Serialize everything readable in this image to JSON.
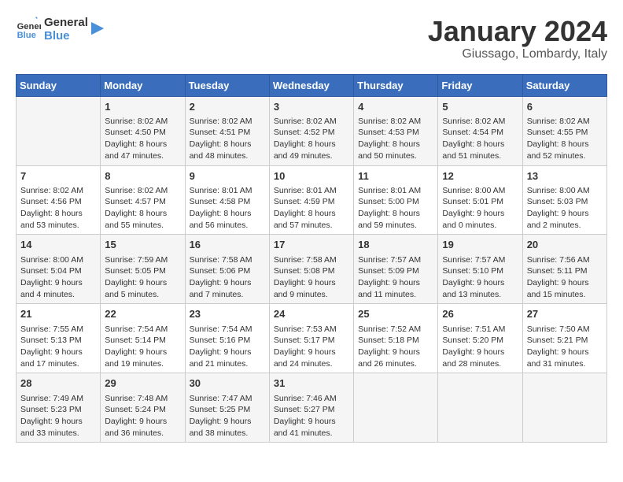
{
  "header": {
    "logo_line1": "General",
    "logo_line2": "Blue",
    "month": "January 2024",
    "location": "Giussago, Lombardy, Italy"
  },
  "days_of_week": [
    "Sunday",
    "Monday",
    "Tuesday",
    "Wednesday",
    "Thursday",
    "Friday",
    "Saturday"
  ],
  "weeks": [
    [
      {
        "day": "",
        "info": ""
      },
      {
        "day": "1",
        "info": "Sunrise: 8:02 AM\nSunset: 4:50 PM\nDaylight: 8 hours\nand 47 minutes."
      },
      {
        "day": "2",
        "info": "Sunrise: 8:02 AM\nSunset: 4:51 PM\nDaylight: 8 hours\nand 48 minutes."
      },
      {
        "day": "3",
        "info": "Sunrise: 8:02 AM\nSunset: 4:52 PM\nDaylight: 8 hours\nand 49 minutes."
      },
      {
        "day": "4",
        "info": "Sunrise: 8:02 AM\nSunset: 4:53 PM\nDaylight: 8 hours\nand 50 minutes."
      },
      {
        "day": "5",
        "info": "Sunrise: 8:02 AM\nSunset: 4:54 PM\nDaylight: 8 hours\nand 51 minutes."
      },
      {
        "day": "6",
        "info": "Sunrise: 8:02 AM\nSunset: 4:55 PM\nDaylight: 8 hours\nand 52 minutes."
      }
    ],
    [
      {
        "day": "7",
        "info": "Sunrise: 8:02 AM\nSunset: 4:56 PM\nDaylight: 8 hours\nand 53 minutes."
      },
      {
        "day": "8",
        "info": "Sunrise: 8:02 AM\nSunset: 4:57 PM\nDaylight: 8 hours\nand 55 minutes."
      },
      {
        "day": "9",
        "info": "Sunrise: 8:01 AM\nSunset: 4:58 PM\nDaylight: 8 hours\nand 56 minutes."
      },
      {
        "day": "10",
        "info": "Sunrise: 8:01 AM\nSunset: 4:59 PM\nDaylight: 8 hours\nand 57 minutes."
      },
      {
        "day": "11",
        "info": "Sunrise: 8:01 AM\nSunset: 5:00 PM\nDaylight: 8 hours\nand 59 minutes."
      },
      {
        "day": "12",
        "info": "Sunrise: 8:00 AM\nSunset: 5:01 PM\nDaylight: 9 hours\nand 0 minutes."
      },
      {
        "day": "13",
        "info": "Sunrise: 8:00 AM\nSunset: 5:03 PM\nDaylight: 9 hours\nand 2 minutes."
      }
    ],
    [
      {
        "day": "14",
        "info": "Sunrise: 8:00 AM\nSunset: 5:04 PM\nDaylight: 9 hours\nand 4 minutes."
      },
      {
        "day": "15",
        "info": "Sunrise: 7:59 AM\nSunset: 5:05 PM\nDaylight: 9 hours\nand 5 minutes."
      },
      {
        "day": "16",
        "info": "Sunrise: 7:58 AM\nSunset: 5:06 PM\nDaylight: 9 hours\nand 7 minutes."
      },
      {
        "day": "17",
        "info": "Sunrise: 7:58 AM\nSunset: 5:08 PM\nDaylight: 9 hours\nand 9 minutes."
      },
      {
        "day": "18",
        "info": "Sunrise: 7:57 AM\nSunset: 5:09 PM\nDaylight: 9 hours\nand 11 minutes."
      },
      {
        "day": "19",
        "info": "Sunrise: 7:57 AM\nSunset: 5:10 PM\nDaylight: 9 hours\nand 13 minutes."
      },
      {
        "day": "20",
        "info": "Sunrise: 7:56 AM\nSunset: 5:11 PM\nDaylight: 9 hours\nand 15 minutes."
      }
    ],
    [
      {
        "day": "21",
        "info": "Sunrise: 7:55 AM\nSunset: 5:13 PM\nDaylight: 9 hours\nand 17 minutes."
      },
      {
        "day": "22",
        "info": "Sunrise: 7:54 AM\nSunset: 5:14 PM\nDaylight: 9 hours\nand 19 minutes."
      },
      {
        "day": "23",
        "info": "Sunrise: 7:54 AM\nSunset: 5:16 PM\nDaylight: 9 hours\nand 21 minutes."
      },
      {
        "day": "24",
        "info": "Sunrise: 7:53 AM\nSunset: 5:17 PM\nDaylight: 9 hours\nand 24 minutes."
      },
      {
        "day": "25",
        "info": "Sunrise: 7:52 AM\nSunset: 5:18 PM\nDaylight: 9 hours\nand 26 minutes."
      },
      {
        "day": "26",
        "info": "Sunrise: 7:51 AM\nSunset: 5:20 PM\nDaylight: 9 hours\nand 28 minutes."
      },
      {
        "day": "27",
        "info": "Sunrise: 7:50 AM\nSunset: 5:21 PM\nDaylight: 9 hours\nand 31 minutes."
      }
    ],
    [
      {
        "day": "28",
        "info": "Sunrise: 7:49 AM\nSunset: 5:23 PM\nDaylight: 9 hours\nand 33 minutes."
      },
      {
        "day": "29",
        "info": "Sunrise: 7:48 AM\nSunset: 5:24 PM\nDaylight: 9 hours\nand 36 minutes."
      },
      {
        "day": "30",
        "info": "Sunrise: 7:47 AM\nSunset: 5:25 PM\nDaylight: 9 hours\nand 38 minutes."
      },
      {
        "day": "31",
        "info": "Sunrise: 7:46 AM\nSunset: 5:27 PM\nDaylight: 9 hours\nand 41 minutes."
      },
      {
        "day": "",
        "info": ""
      },
      {
        "day": "",
        "info": ""
      },
      {
        "day": "",
        "info": ""
      }
    ]
  ]
}
